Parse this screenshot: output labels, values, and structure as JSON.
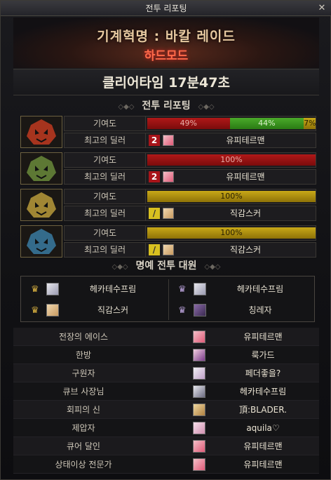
{
  "window": {
    "title": "전투 리포팅",
    "close_glyph": "✕"
  },
  "banner": {
    "title": "기계혁명 : 바칼 레이드",
    "subtitle": "하드모드"
  },
  "clear_time": "클리어타임  17분47초",
  "section_report": "전투 리포팅",
  "section_honor": "명예 전투 대원",
  "section_deco": "◇◆◇",
  "labels": {
    "contribution": "기여도",
    "best_dealer": "최고의 딜러"
  },
  "bosses": [
    {
      "icon": "red-dragon-boss-icon",
      "color": "#c03a20",
      "contribution": [
        {
          "value": "49%",
          "fill": 0.49,
          "color": "red"
        },
        {
          "value": "44%",
          "fill": 0.44,
          "color": "green"
        },
        {
          "value": "7%",
          "fill": 0.07,
          "color": "gold"
        }
      ],
      "dealer_badge": "2",
      "dealer_name": "유피테르맨"
    },
    {
      "icon": "green-dragon-boss-icon",
      "color": "#6a8a3a",
      "contribution": [
        {
          "value": "100%",
          "fill": 1.0,
          "color": "red"
        }
      ],
      "dealer_badge": "2",
      "dealer_name": "유피테르맨"
    },
    {
      "icon": "gold-dragon-boss-icon",
      "color": "#b89a3a",
      "contribution": [
        {
          "value": "100%",
          "fill": 1.0,
          "color": "gold"
        }
      ],
      "dealer_badge": "/",
      "dealer_name": "직감스커"
    },
    {
      "icon": "blue-dragon-boss-icon",
      "color": "#3a7aa0",
      "contribution": [
        {
          "value": "100%",
          "fill": 1.0,
          "color": "gold"
        }
      ],
      "dealer_badge": "/",
      "dealer_name": "직감스커"
    }
  ],
  "honor": [
    {
      "name": "헤카테수프림",
      "crown": "♛"
    },
    {
      "name": "헤카테수프림",
      "crown": "♛"
    },
    {
      "name": "직감스커",
      "crown": "♛"
    },
    {
      "name": "칭레자",
      "crown": "♛"
    }
  ],
  "awards": [
    {
      "title": "전장의 에이스",
      "name": "유피테르맨"
    },
    {
      "title": "한방",
      "name": "룩가드"
    },
    {
      "title": "구원자",
      "name": "페더좋을?"
    },
    {
      "title": "큐브 사장님",
      "name": "헤카테수프림"
    },
    {
      "title": "회피의 신",
      "name": "頂:BLADER."
    },
    {
      "title": "제압자",
      "name": "aquila♡"
    },
    {
      "title": "큐어 달인",
      "name": "유피테르맨"
    },
    {
      "title": "상태이상 전문가",
      "name": "유피테르맨"
    }
  ],
  "colors": {
    "red_bar": "#b01818",
    "green_bar": "#4aaa2a",
    "gold_bar": "#c8a818",
    "accent": "#ff6a4a"
  }
}
